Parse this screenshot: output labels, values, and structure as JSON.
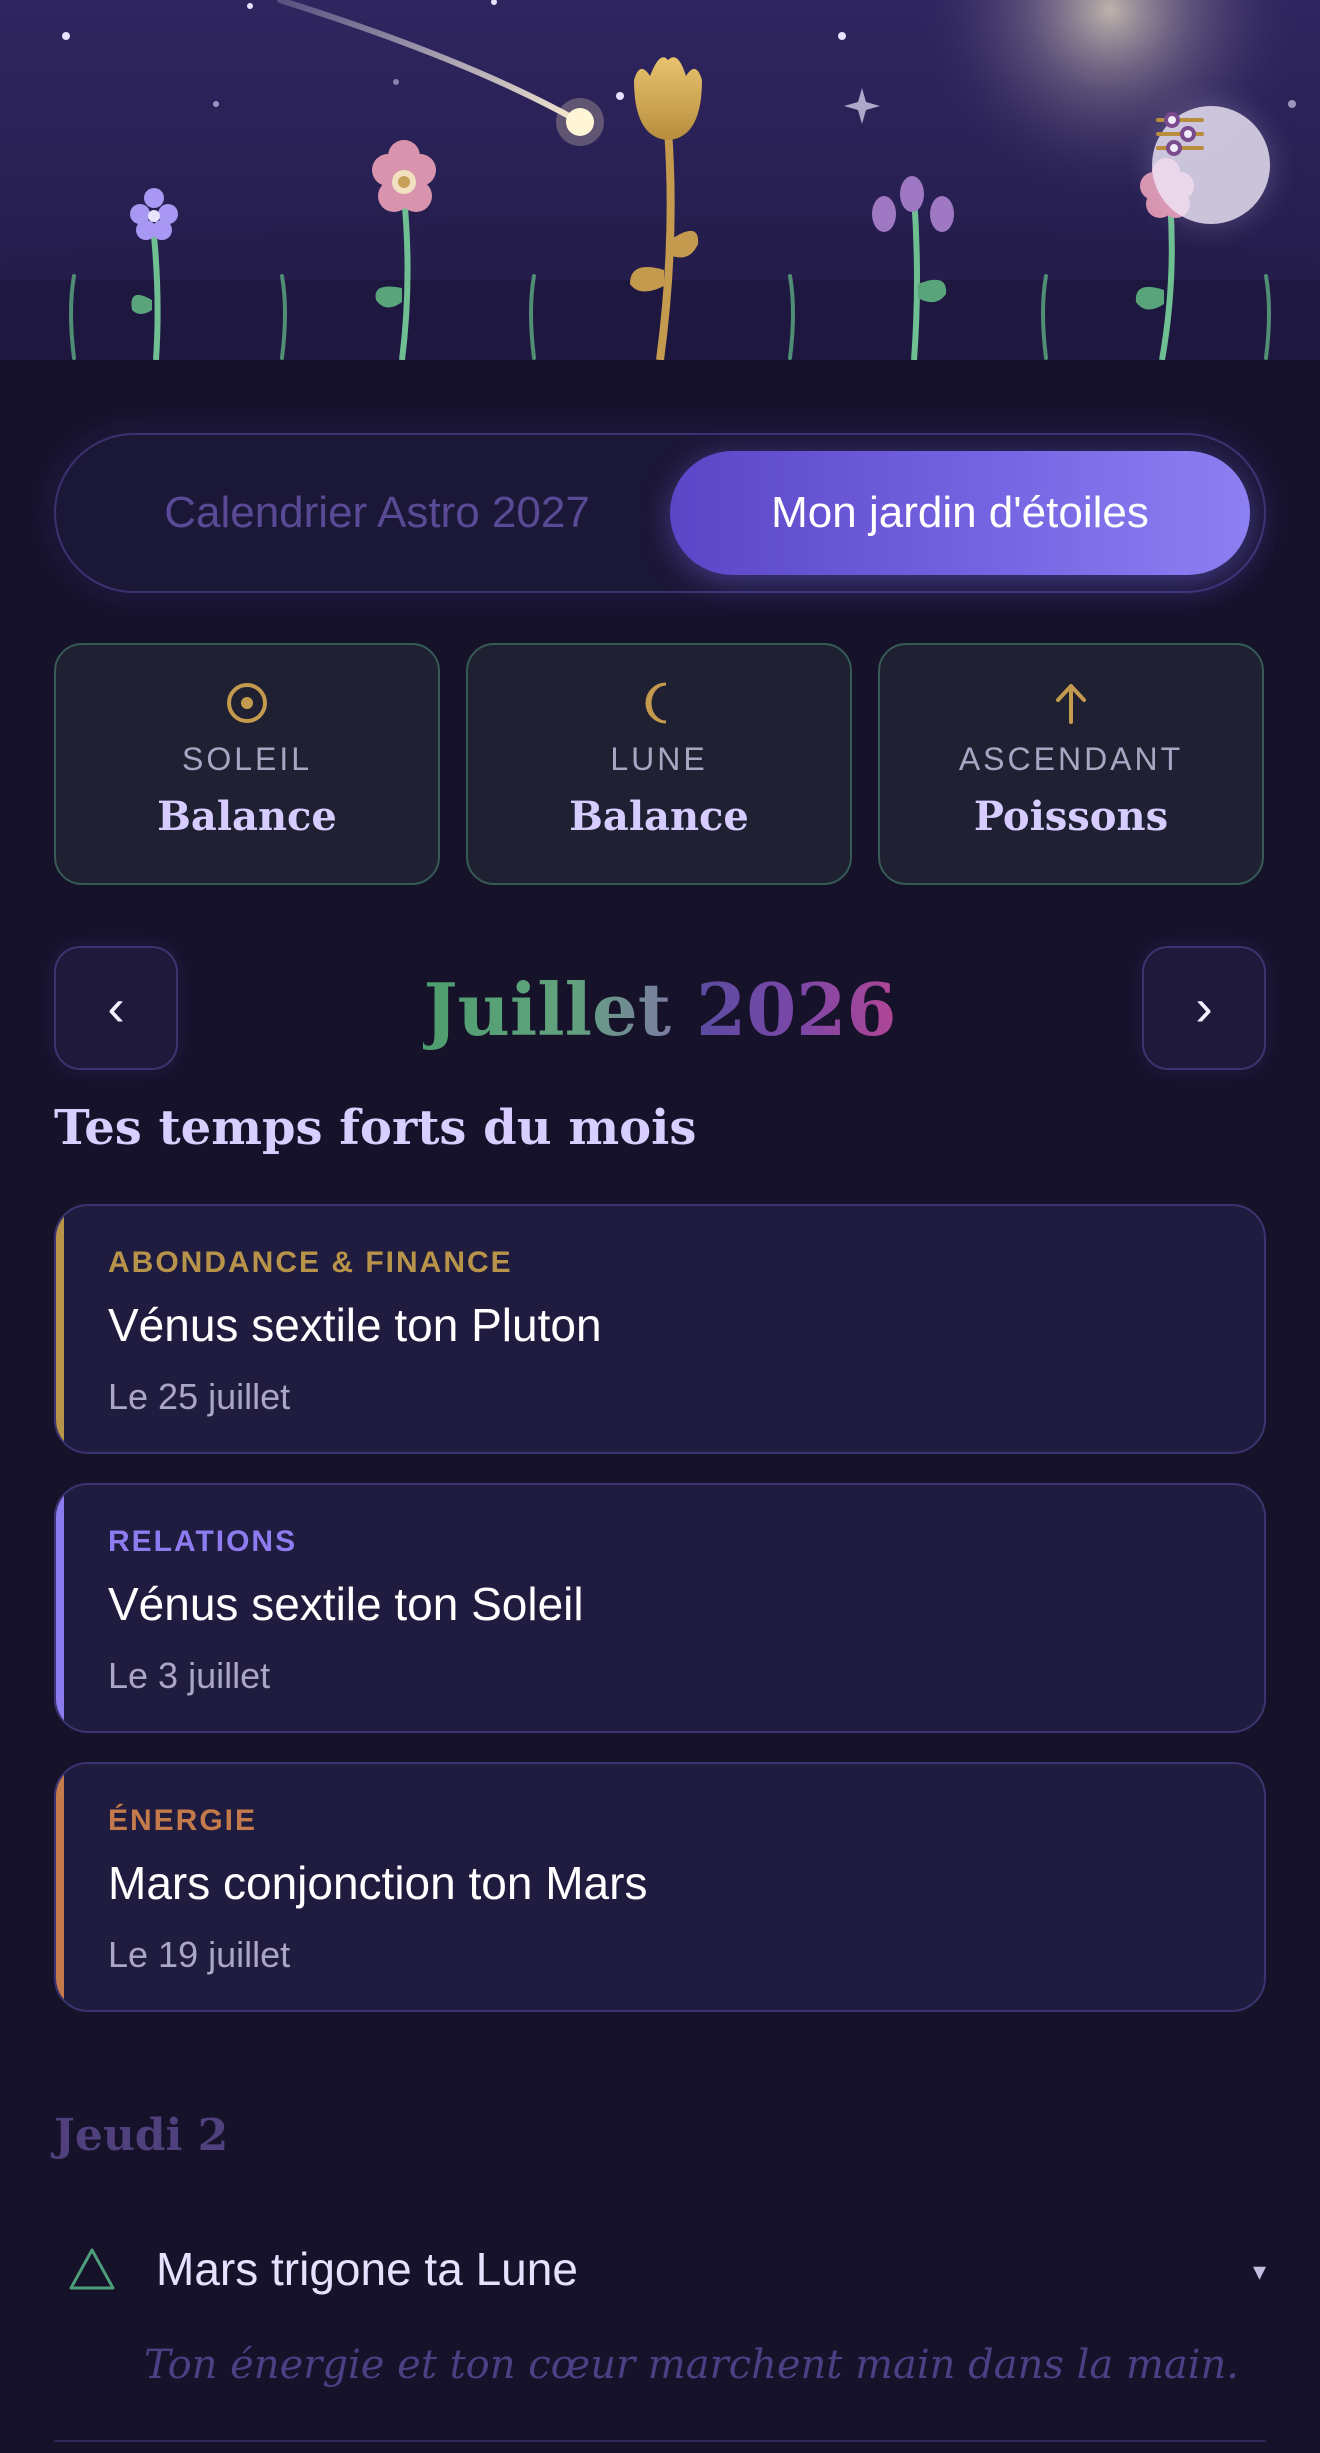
{
  "header": {
    "settings_icon": "sliders-icon"
  },
  "toggle": {
    "options": [
      "Calendrier Astro 2027",
      "Mon jardin d'étoiles"
    ],
    "selected": "Mon jardin d'étoiles"
  },
  "signs": [
    {
      "icon": "sun-icon",
      "label": "SOLEIL",
      "value": "Balance"
    },
    {
      "icon": "moon-icon",
      "label": "LUNE",
      "value": "Balance"
    },
    {
      "icon": "arrow-up-icon",
      "label": "ASCENDANT",
      "value": "Poissons"
    }
  ],
  "month_nav": {
    "prev": "‹",
    "next": "›",
    "month": "Juillet",
    "year": "2026"
  },
  "highlights": {
    "title": "Tes temps forts du mois",
    "items": [
      {
        "category": "ABONDANCE & FINANCE",
        "title": "Vénus sextile ton Pluton",
        "date": "Le 25 juillet",
        "color": "#b8934a"
      },
      {
        "category": "RELATIONS",
        "title": "Vénus sextile ton Soleil",
        "date": "Le 3 juillet",
        "color": "#8d7cf0"
      },
      {
        "category": "ÉNERGIE",
        "title": "Mars conjonction ton Mars",
        "date": "Le 19 juillet",
        "color": "#c57a4c"
      }
    ]
  },
  "day": {
    "label": "Jeudi 2",
    "aspect": {
      "icon": "trine-triangle-icon",
      "title": "Mars trigone ta Lune",
      "chevron": "▾",
      "description": "Ton énergie et ton cœur marchent main dans la main."
    }
  },
  "colors": {
    "background": "#15122a",
    "accent": "#7564e2",
    "gold": "#b8934a",
    "green": "#4e9e6e"
  }
}
